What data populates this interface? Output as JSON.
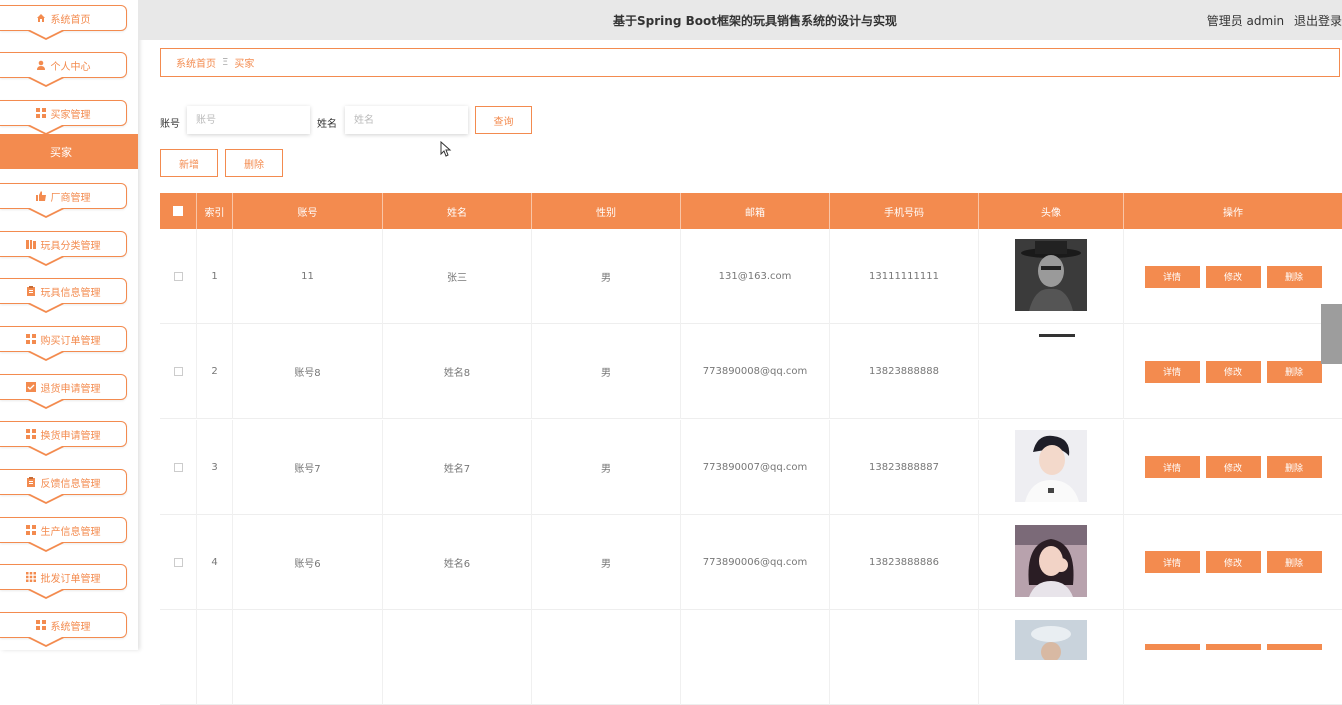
{
  "header": {
    "title": "基于Spring Boot框架的玩具销售系统的设计与实现",
    "role_user": "管理员 admin",
    "logout": "退出登录"
  },
  "sidebar": {
    "items": [
      {
        "label": "系统首页",
        "icon": "home-icon"
      },
      {
        "label": "个人中心",
        "icon": "user-icon"
      },
      {
        "label": "买家管理",
        "icon": "grid-icon"
      },
      {
        "label": "厂商管理",
        "icon": "thumb-icon"
      },
      {
        "label": "玩具分类管理",
        "icon": "book-icon"
      },
      {
        "label": "玩具信息管理",
        "icon": "clipboard-icon"
      },
      {
        "label": "购买订单管理",
        "icon": "grid-icon"
      },
      {
        "label": "退货申请管理",
        "icon": "check-icon"
      },
      {
        "label": "换货申请管理",
        "icon": "grid-icon"
      },
      {
        "label": "反馈信息管理",
        "icon": "clipboard-icon"
      },
      {
        "label": "生产信息管理",
        "icon": "grid-icon"
      },
      {
        "label": "批发订单管理",
        "icon": "apps-icon"
      },
      {
        "label": "系统管理",
        "icon": "grid-icon"
      }
    ],
    "active_label": "买家"
  },
  "breadcrumb": {
    "home": "系统首页",
    "separator": "Ξ",
    "current": "买家"
  },
  "search": {
    "account_label": "账号",
    "account_placeholder": "账号",
    "name_label": "姓名",
    "name_placeholder": "姓名",
    "query_button": "查询"
  },
  "actions": {
    "add": "新增",
    "delete": "删除"
  },
  "table": {
    "headers": [
      "索引",
      "账号",
      "姓名",
      "性别",
      "邮箱",
      "手机号码",
      "头像",
      "操作"
    ],
    "row_buttons": {
      "detail": "详情",
      "edit": "修改",
      "delete": "删除"
    },
    "rows": [
      {
        "index": "1",
        "account": "11",
        "name": "张三",
        "gender": "男",
        "email": "131@163.com",
        "phone": "13111111111",
        "avatar": "avatar-photo-man-hat"
      },
      {
        "index": "2",
        "account": "账号8",
        "name": "姓名8",
        "gender": "男",
        "email": "773890008@qq.com",
        "phone": "13823888888",
        "avatar": "avatar-photo-cropped"
      },
      {
        "index": "3",
        "account": "账号7",
        "name": "姓名7",
        "gender": "男",
        "email": "773890007@qq.com",
        "phone": "13823888887",
        "avatar": "avatar-photo-young-man"
      },
      {
        "index": "4",
        "account": "账号6",
        "name": "姓名6",
        "gender": "男",
        "email": "773890006@qq.com",
        "phone": "13823888886",
        "avatar": "avatar-photo-girl"
      }
    ]
  },
  "colors": {
    "accent": "#f38b4f",
    "header_bg": "#e8e8e8"
  }
}
